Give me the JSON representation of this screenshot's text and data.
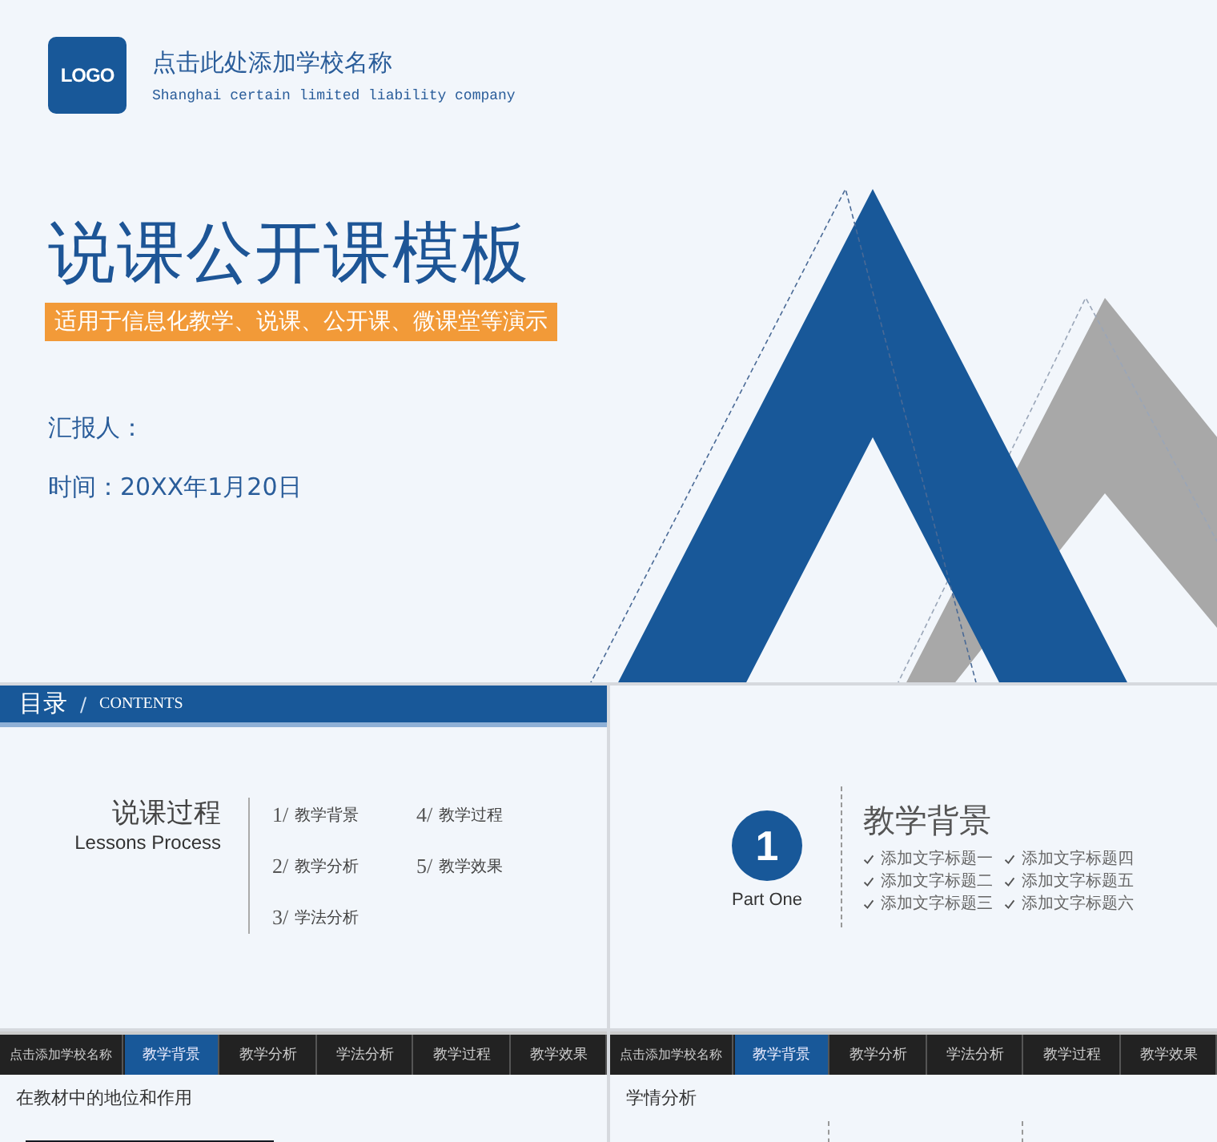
{
  "cover": {
    "logo": "LOGO",
    "school": "点击此处添加学校名称",
    "company": "Shanghai certain limited liability company",
    "title": "说课公开课模板",
    "subtitle": "适用于信息化教学、说课、公开课、微课堂等演示",
    "reporter": "汇报人：",
    "date": "时间：20XX年1月20日"
  },
  "contents": {
    "header": "目录",
    "header_separator": "/",
    "header_en": "CONTENTS",
    "heading": "说课过程",
    "heading_en": "Lessons Process",
    "items": [
      {
        "number": "1/",
        "label": "教学背景"
      },
      {
        "number": "2/",
        "label": "教学分析"
      },
      {
        "number": "3/",
        "label": "学法分析"
      },
      {
        "number": "4/",
        "label": "教学过程"
      },
      {
        "number": "5/",
        "label": "教学效果"
      }
    ]
  },
  "section": {
    "number": "1",
    "part": "Part One",
    "title": "教学背景",
    "points": [
      "添加文字标题一",
      "添加文字标题二",
      "添加文字标题三",
      "添加文字标题四",
      "添加文字标题五",
      "添加文字标题六"
    ]
  },
  "content_slides": [
    {
      "nav": [
        {
          "label": "点击添加学校名称",
          "kind": "school",
          "selected": false
        },
        {
          "label": "教学背景",
          "kind": "tab",
          "selected": true
        },
        {
          "label": "教学分析",
          "kind": "tab",
          "selected": false
        },
        {
          "label": "学法分析",
          "kind": "tab",
          "selected": false
        },
        {
          "label": "教学过程",
          "kind": "tab",
          "selected": false
        },
        {
          "label": "教学效果",
          "kind": "tab",
          "selected": false
        }
      ],
      "title": "在教材中的地位和作用",
      "kind": "photo"
    },
    {
      "nav": [
        {
          "label": "点击添加学校名称",
          "kind": "school",
          "selected": false
        },
        {
          "label": "教学背景",
          "kind": "tab",
          "selected": true
        },
        {
          "label": "教学分析",
          "kind": "tab",
          "selected": false
        },
        {
          "label": "学法分析",
          "kind": "tab",
          "selected": false
        },
        {
          "label": "教学过程",
          "kind": "tab",
          "selected": false
        },
        {
          "label": "教学效果",
          "kind": "tab",
          "selected": false
        }
      ],
      "title": "学情分析",
      "kind": "columns"
    }
  ]
}
